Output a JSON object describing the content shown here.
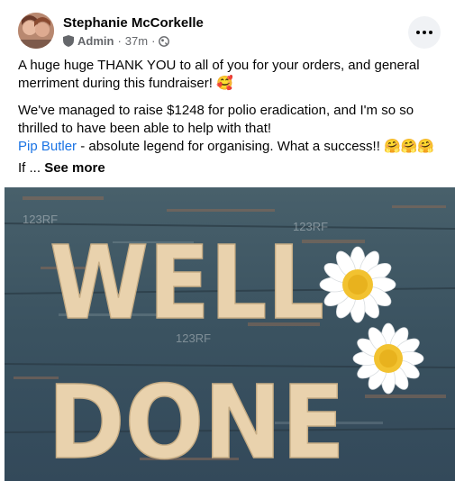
{
  "post": {
    "author": "Stephanie McCorkelle",
    "role": "Admin",
    "time": "37m",
    "separator": "·",
    "more_icon": "more-horizontal-icon",
    "paragraph1": "A huge huge THANK YOU to all of you for your orders, and general merriment during this fundraiser! 🥰",
    "paragraph2_line1": "We've managed to raise $1248 for polio eradication, and I'm so so thrilled to have been able to help with that!",
    "mention": "Pip Butler",
    "paragraph2_rest": " - absolute legend for organising. What a success!! 🤗🤗🤗",
    "truncated_start": "If ...",
    "see_more": "See more"
  },
  "image": {
    "line1": "WELL",
    "line2": "DONE",
    "watermark": "123RF"
  },
  "colors": {
    "mention": "#1b74e4",
    "secondary_text": "#65676b",
    "wood_background": "#3e5560",
    "letters": "#e9d2ad",
    "flower_center": "#f2c230"
  }
}
